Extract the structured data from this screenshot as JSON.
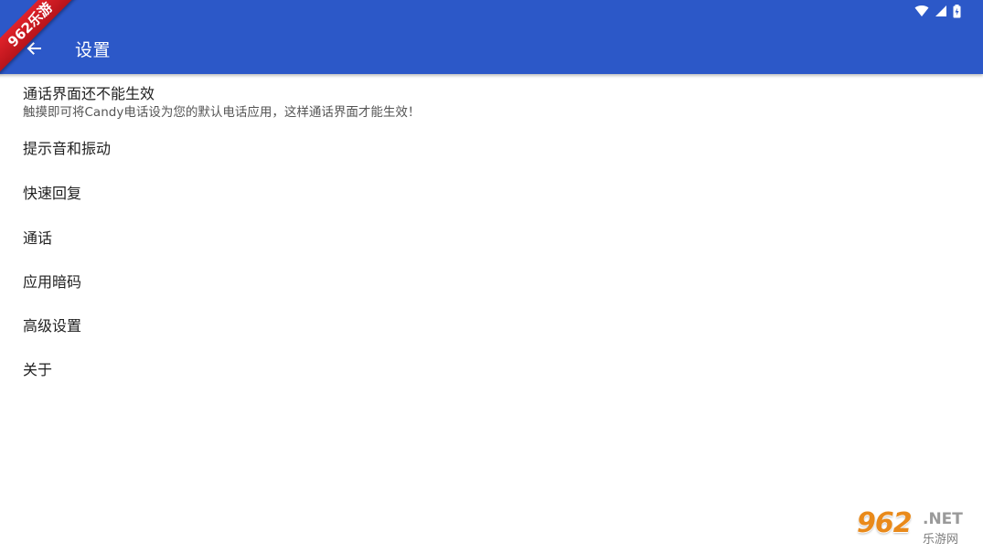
{
  "appbar": {
    "title": "设置",
    "color": "#2c58c8",
    "back_icon": "arrow-left-icon"
  },
  "status_bar": {
    "icons": [
      "wifi-icon",
      "cellular-signal-icon",
      "battery-icon"
    ]
  },
  "corner_badge": {
    "text": "962乐游",
    "color": "#d71920"
  },
  "settings": {
    "items": [
      {
        "title": "通话界面还不能生效",
        "summary": "触摸即可将Candy电话设为您的默认电话应用，这样通话界面才能生效！"
      },
      {
        "title": "提示音和振动"
      },
      {
        "title": "快速回复"
      },
      {
        "title": "通话"
      },
      {
        "title": "应用暗码"
      },
      {
        "title": "高级设置"
      },
      {
        "title": "关于"
      }
    ]
  },
  "watermark": {
    "big": "962",
    "net": ".NET",
    "sub": "乐游网"
  }
}
